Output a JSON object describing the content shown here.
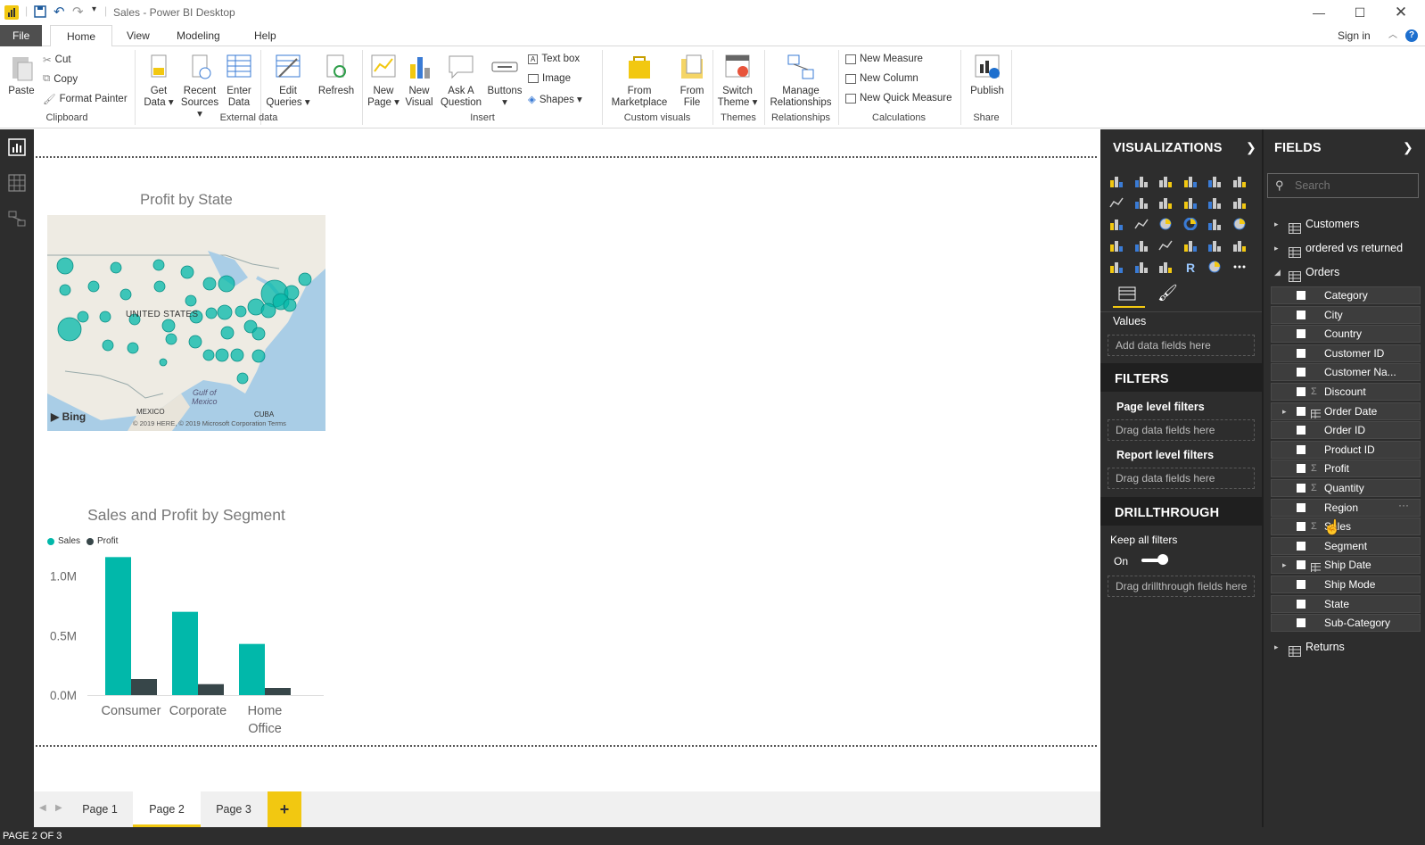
{
  "window": {
    "title": "Sales - Power BI Desktop"
  },
  "menu": {
    "tabs": [
      "File",
      "Home",
      "View",
      "Modeling",
      "Help"
    ],
    "sign_in": "Sign in"
  },
  "ribbon": {
    "clipboard": {
      "paste": "Paste",
      "cut": "Cut",
      "copy": "Copy",
      "format_painter": "Format Painter",
      "group": "Clipboard"
    },
    "external_data": {
      "get_data": [
        "Get",
        "Data ▾"
      ],
      "recent_sources": [
        "Recent",
        "Sources ▾"
      ],
      "enter_data": [
        "Enter",
        "Data"
      ],
      "edit_queries": [
        "Edit",
        "Queries ▾"
      ],
      "refresh": "Refresh",
      "group": "External data"
    },
    "insert": {
      "new_page": [
        "New",
        "Page ▾"
      ],
      "new_visual": [
        "New",
        "Visual"
      ],
      "ask_question": [
        "Ask A",
        "Question"
      ],
      "buttons": [
        "Buttons",
        "▾"
      ],
      "text_box": "Text box",
      "image": "Image",
      "shapes": "Shapes ▾",
      "group": "Insert"
    },
    "custom_visuals": {
      "from_marketplace": [
        "From",
        "Marketplace"
      ],
      "from_file": [
        "From",
        "File"
      ],
      "group": "Custom visuals"
    },
    "themes": {
      "switch_theme": [
        "Switch",
        "Theme ▾"
      ],
      "group": "Themes"
    },
    "relationships": {
      "manage": [
        "Manage",
        "Relationships"
      ],
      "group": "Relationships"
    },
    "calculations": {
      "new_measure": "New Measure",
      "new_column": "New Column",
      "new_quick_measure": "New Quick Measure",
      "group": "Calculations"
    },
    "share": {
      "publish": "Publish",
      "group": "Share"
    }
  },
  "map_visual": {
    "title": "Profit by State",
    "label_us": "UNITED STATES",
    "label_gulf": [
      "Gulf of",
      "Mexico"
    ],
    "label_mexico": "MEXICO",
    "label_cuba": "CUBA",
    "bing": "Bing",
    "copyright": "© 2019 HERE, © 2019 Microsoft Corporation Terms"
  },
  "chart_data": {
    "type": "bar",
    "title": "Sales and Profit by Segment",
    "categories": [
      "Consumer",
      "Corporate",
      "Home Office"
    ],
    "series": [
      {
        "name": "Sales",
        "values": [
          1160000,
          700000,
          430000
        ],
        "color": "#01B8AA"
      },
      {
        "name": "Profit",
        "values": [
          135000,
          92000,
          60000
        ],
        "color": "#374649"
      }
    ],
    "yticks": [
      "1.0M",
      "0.5M",
      "0.0M"
    ],
    "ylim": [
      0,
      1200000
    ],
    "legend": "top-left",
    "grid": false
  },
  "pages": {
    "tabs": [
      "Page 1",
      "Page 2",
      "Page 3"
    ],
    "add": "+",
    "status": "PAGE 2 OF 3"
  },
  "visualizations": {
    "header": "VISUALIZATIONS",
    "values_label": "Values",
    "values_placeholder": "Add data fields here"
  },
  "filters": {
    "header": "FILTERS",
    "page_level": "Page level filters",
    "page_drag": "Drag data fields here",
    "report_level": "Report level filters",
    "report_drag": "Drag data fields here"
  },
  "drillthrough": {
    "header": "DRILLTHROUGH",
    "keep_all": "Keep all filters",
    "toggle": "On",
    "drag": "Drag drillthrough fields here"
  },
  "fields": {
    "header": "FIELDS",
    "search_placeholder": "Search",
    "tables_top": [
      "Customers",
      "ordered vs returned",
      "Orders"
    ],
    "orders_fields": [
      "Category",
      "City",
      "Country",
      "Customer ID",
      "Customer Na...",
      "Discount",
      "Order Date",
      "Order ID",
      "Product ID",
      "Profit",
      "Quantity",
      "Region",
      "Sales",
      "Segment",
      "Ship Date",
      "Ship Mode",
      "State",
      "Sub-Category"
    ],
    "sigma_fields": [
      "Discount",
      "Profit",
      "Quantity",
      "Sales"
    ],
    "date_fields": [
      "Order Date",
      "Ship Date"
    ],
    "tables_bottom": [
      "Returns"
    ]
  },
  "colors": {
    "accent": "#F2C811",
    "teal": "#01B8AA",
    "dark": "#374649",
    "pane": "#2D2D2D"
  }
}
